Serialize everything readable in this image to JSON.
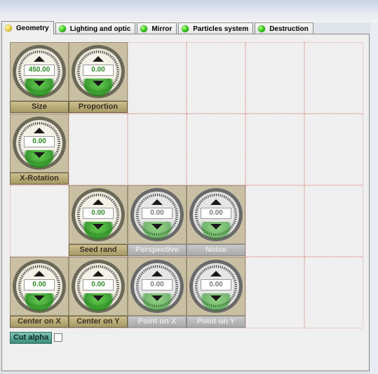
{
  "tabs": [
    {
      "label": "Geometry",
      "active": true,
      "icon": "yellow-status-icon"
    },
    {
      "label": "Lighting and optic",
      "active": false,
      "icon": "green-status-icon"
    },
    {
      "label": "Mirror",
      "active": false,
      "icon": "green-status-icon"
    },
    {
      "label": "Particles system",
      "active": false,
      "icon": "green-status-icon"
    },
    {
      "label": "Destruction",
      "active": false,
      "icon": "green-status-icon"
    }
  ],
  "knobs": [
    {
      "label": "Size",
      "value": "450.00",
      "enabled": true
    },
    {
      "label": "Proportion",
      "value": "0.00",
      "enabled": true
    },
    {
      "label": "X-Rotation",
      "value": "0.00",
      "enabled": true
    },
    {
      "label": "Seed rand",
      "value": "0.00",
      "enabled": true
    },
    {
      "label": "Perspective",
      "value": "0.00",
      "enabled": false
    },
    {
      "label": "Noise",
      "value": "0.00",
      "enabled": false
    },
    {
      "label": "Center on X",
      "value": "0.00",
      "enabled": true
    },
    {
      "label": "Center on Y",
      "value": "0.00",
      "enabled": true
    },
    {
      "label": "Point on X",
      "value": "0.00",
      "enabled": false
    },
    {
      "label": "Point on Y",
      "value": "0.00",
      "enabled": false
    }
  ],
  "cut_alpha": {
    "label": "Cut alpha",
    "checked": false
  }
}
